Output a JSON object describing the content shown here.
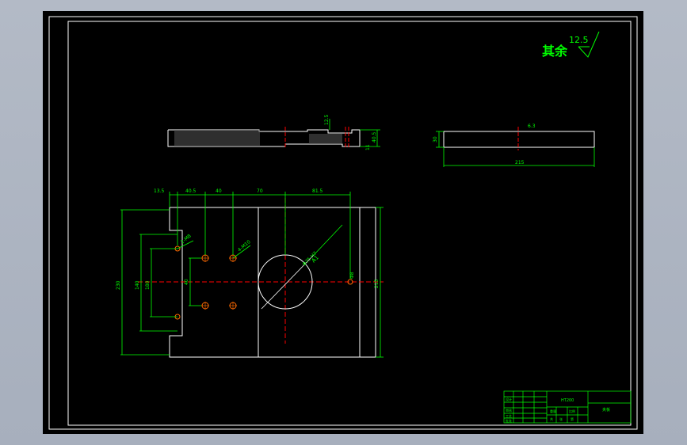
{
  "colors": {
    "background": "#000000",
    "outline": "#ffffff",
    "dimension": "#00ff00",
    "centerline": "#ff0000",
    "holes": "#ff6a00",
    "title_block": "#00ff00"
  },
  "drawing": {
    "roughness_note": {
      "text": "其余",
      "value": "12.5"
    },
    "side_view": {
      "dims": [
        "12.5",
        "40.5",
        "11"
      ]
    },
    "end_view": {
      "height_dim": "30",
      "width_dim": "215",
      "roughness": "6.3"
    },
    "plan_view": {
      "top_dims": [
        "13.5",
        "40.5",
        "40",
        "70",
        "81.5"
      ],
      "overall_width": "215",
      "left_dims": [
        "230",
        "140",
        "180"
      ],
      "inner_dim": "40",
      "hole_notes": [
        "2-M8",
        "4-M10"
      ],
      "bore_note": "Φ75 H7",
      "bore_label": "A1",
      "small_hole_note": "Φ8"
    },
    "title_block": {
      "part_name": "夹板",
      "material": "HT200",
      "cells": [
        "标记",
        "处数",
        "分区",
        "更改文件号",
        "签名",
        "年月日",
        "设计",
        "审核",
        "工艺",
        "批准",
        "阶段标记",
        "重量",
        "比例",
        "共",
        "张",
        "第"
      ]
    }
  }
}
